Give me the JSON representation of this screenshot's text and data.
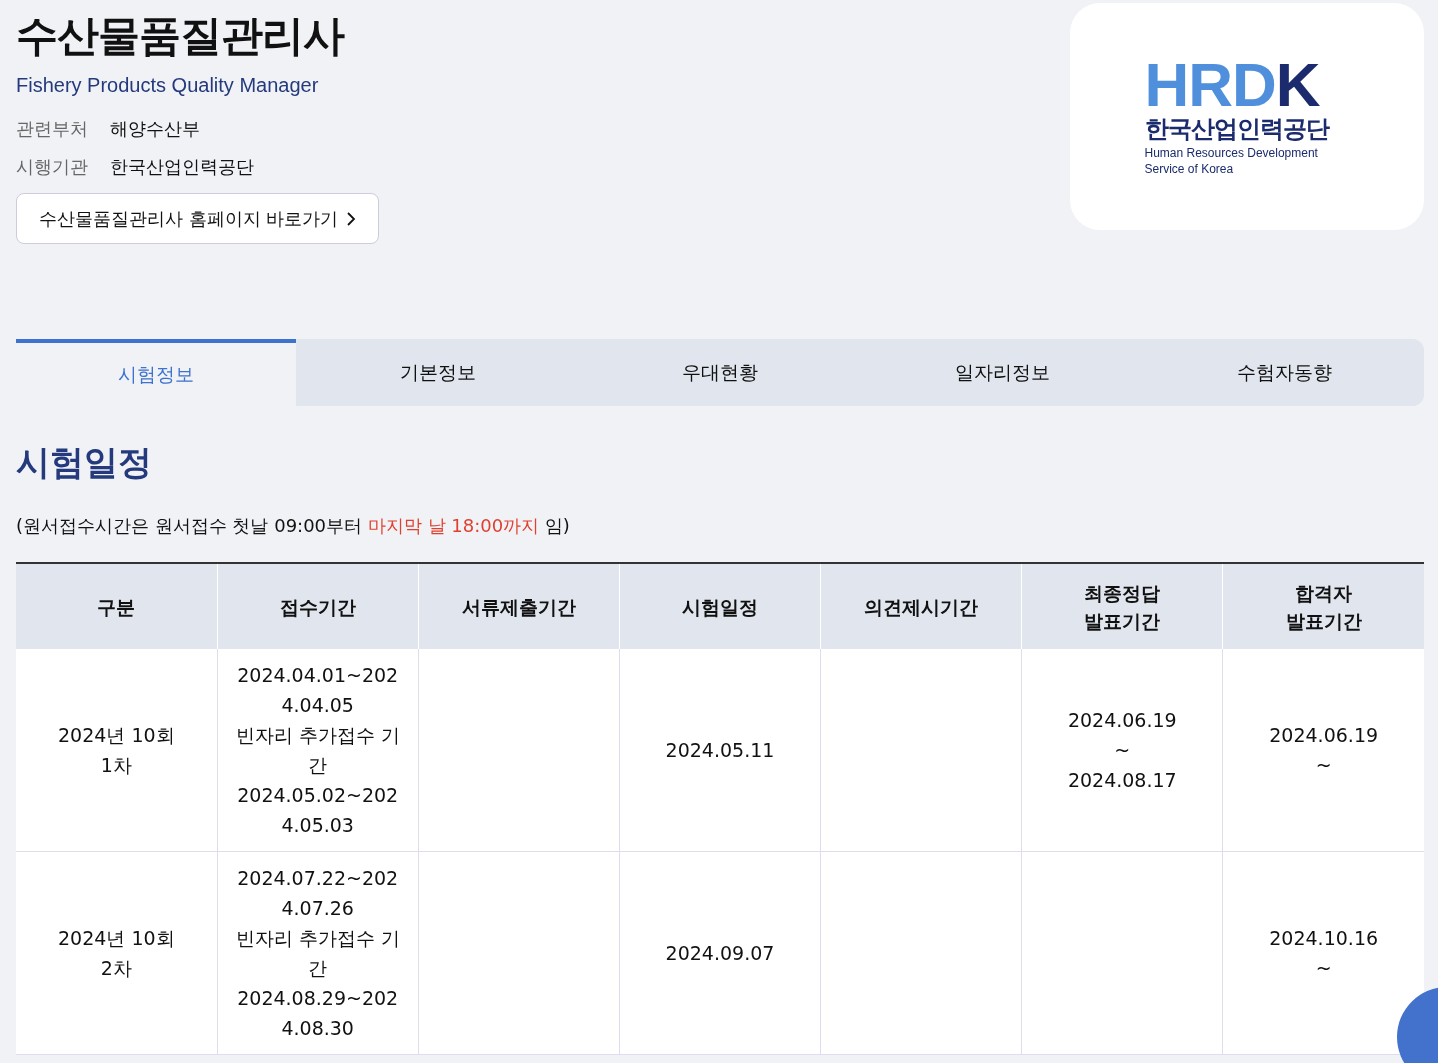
{
  "title": "수산물품질관리사",
  "subtitle": "Fishery Products Quality Manager",
  "info": [
    {
      "label": "관련부처",
      "value": "해양수산부"
    },
    {
      "label": "시행기관",
      "value": "한국산업인력공단"
    }
  ],
  "homepage_button": "수산물품질관리사 홈페이지 바로가기",
  "logo": {
    "mark": "HRDK",
    "name": "한국산업인력공단",
    "english": [
      "Human Resources Development",
      "Service of Korea"
    ]
  },
  "tabs": [
    {
      "label": "시험정보",
      "selected": true
    },
    {
      "label": "기본정보",
      "selected": false
    },
    {
      "label": "우대현황",
      "selected": false
    },
    {
      "label": "일자리정보",
      "selected": false
    },
    {
      "label": "수험자동향",
      "selected": false
    }
  ],
  "section_title": "시험일정",
  "note": [
    {
      "text": "(원서접수시간은 원서접수 첫날 09:00부터 ",
      "highlight": false
    },
    {
      "text": "마지막 날 18:00까지",
      "highlight": true
    },
    {
      "text": " 임)",
      "highlight": false
    }
  ],
  "table": {
    "columns": [
      "구분",
      "접수기간",
      "서류제출기간",
      "시험일정",
      "의견제시기간",
      "최종정답\n발표기간",
      "합격자\n발표기간"
    ],
    "rows": [
      [
        "2024년 10회\n1차",
        "2024.04.01~2024.04.05\n빈자리 추가접수 기간\n2024.05.02~2024.05.03",
        null,
        "2024.05.11",
        null,
        "2024.06.19\n~\n2024.08.17",
        "2024.06.19\n~"
      ],
      [
        "2024년 10회\n2차",
        "2024.07.22~2024.07.26\n빈자리 추가접수 기간\n2024.08.29~2024.08.30",
        null,
        "2024.09.07",
        null,
        null,
        "2024.10.16\n~"
      ]
    ]
  }
}
